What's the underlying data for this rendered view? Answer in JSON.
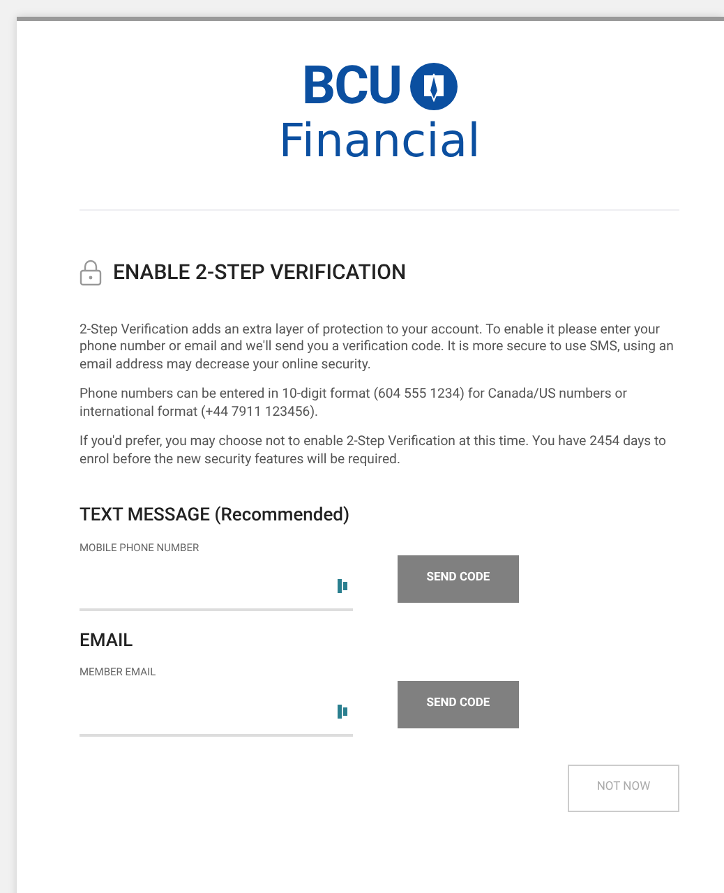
{
  "logo": {
    "name": "BCU",
    "subtitle": "Financial"
  },
  "title": "ENABLE 2-STEP VERIFICATION",
  "paragraphs": [
    "2-Step Verification adds an extra layer of protection to your account. To enable it please enter your phone number or email and we'll send you a verification code. It is more secure to use SMS, using an email address may decrease your online security.",
    "Phone numbers can be entered in 10-digit format (604 555 1234) for Canada/US numbers or international format (+44 7911 123456).",
    "If you'd prefer, you may choose not to enable 2-Step Verification at this time. You have 2454 days to enrol before the new security features will be required."
  ],
  "sections": [
    {
      "heading": "TEXT MESSAGE (Recommended)",
      "field_label": "MOBILE PHONE NUMBER",
      "button": "SEND CODE"
    },
    {
      "heading": "EMAIL",
      "field_label": "MEMBER EMAIL",
      "button": "SEND CODE"
    }
  ],
  "footer_button": "NOT NOW"
}
